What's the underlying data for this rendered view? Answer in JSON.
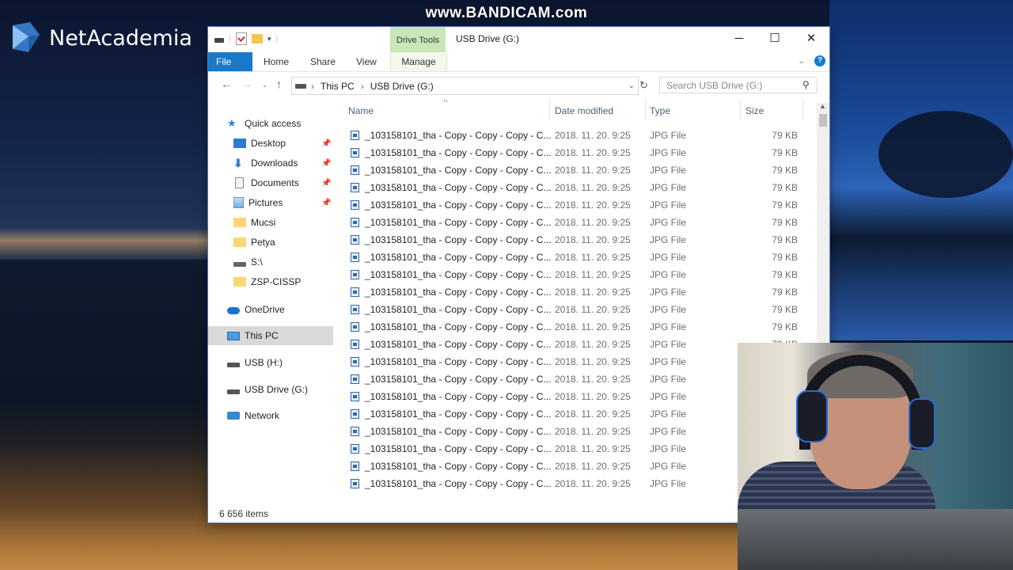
{
  "watermark": "www.BANDICAM.com",
  "logo": {
    "text": "NetAcademia"
  },
  "window": {
    "title": "USB Drive (G:)",
    "context_tab": "Drive Tools",
    "ribbon_tabs": [
      "File",
      "Home",
      "Share",
      "View",
      "Manage"
    ],
    "address_path": [
      "This PC",
      "USB Drive (G:)"
    ],
    "search_placeholder": "Search USB Drive (G:)",
    "status": "6 656 items"
  },
  "nav": {
    "quick_access": "Quick access",
    "items": [
      {
        "label": "Desktop",
        "icon": "desktop-icon",
        "pinned": true
      },
      {
        "label": "Downloads",
        "icon": "download-icon",
        "pinned": true
      },
      {
        "label": "Documents",
        "icon": "documents-icon",
        "pinned": true
      },
      {
        "label": "Pictures",
        "icon": "pictures-icon",
        "pinned": true
      },
      {
        "label": "Mucsi",
        "icon": "folder-icon",
        "pinned": false
      },
      {
        "label": "Petya",
        "icon": "folder-icon",
        "pinned": false
      },
      {
        "label": "S:\\",
        "icon": "drive-icon",
        "pinned": false
      },
      {
        "label": "ZSP-CISSP",
        "icon": "folder-icon",
        "pinned": false
      }
    ],
    "onedrive": "OneDrive",
    "this_pc": "This PC",
    "usb_h": "USB (H:)",
    "usb_g": "USB Drive (G:)",
    "network": "Network"
  },
  "columns": {
    "name": "Name",
    "date": "Date modified",
    "type": "Type",
    "size": "Size"
  },
  "file_row": {
    "name": "_103158101_tha - Copy - Copy - Copy - C...",
    "date": "2018. 11. 20. 9:25",
    "type": "JPG File",
    "size": "79 KB"
  },
  "colors": {
    "accent": "#1979ca",
    "drive_tools": "#c9e7b6"
  }
}
